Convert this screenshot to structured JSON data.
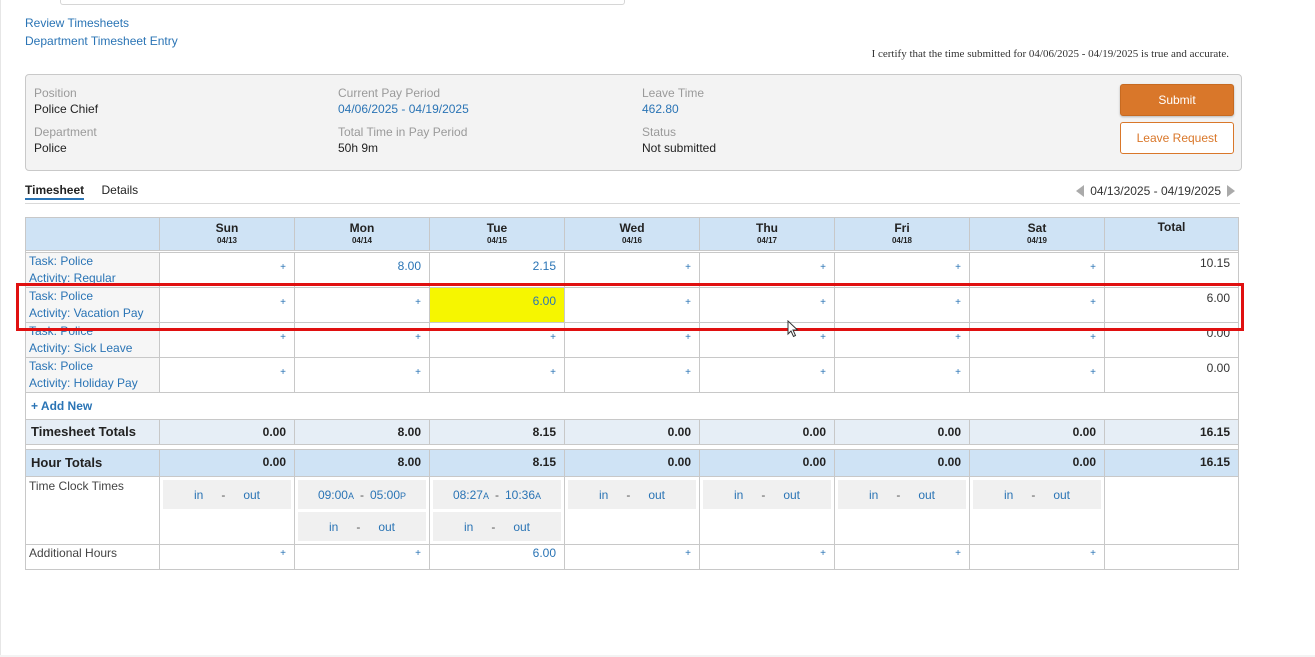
{
  "nav_links": {
    "review_timesheets": "Review Timesheets",
    "department_entry": "Department Timesheet Entry"
  },
  "certify_text": "I certify that the time submitted for 04/06/2025 - 04/19/2025 is true and accurate.",
  "info": {
    "position_label": "Position",
    "position_value": "Police Chief",
    "department_label": "Department",
    "department_value": "Police",
    "pay_period_label": "Current Pay Period",
    "pay_period_value": "04/06/2025 - 04/19/2025",
    "total_time_label": "Total Time in Pay Period",
    "total_time_value": "50h 9m",
    "leave_label": "Leave Time",
    "leave_value": "462.80",
    "status_label": "Status",
    "status_value": "Not submitted"
  },
  "buttons": {
    "submit": "Submit",
    "leave_request": "Leave Request"
  },
  "tabs": [
    "Timesheet",
    "Details"
  ],
  "week_range": "04/13/2025 - 04/19/2025",
  "columns": [
    {
      "day": "Sun",
      "date": "04/13"
    },
    {
      "day": "Mon",
      "date": "04/14"
    },
    {
      "day": "Tue",
      "date": "04/15"
    },
    {
      "day": "Wed",
      "date": "04/16"
    },
    {
      "day": "Thu",
      "date": "04/17"
    },
    {
      "day": "Fri",
      "date": "04/18"
    },
    {
      "day": "Sat",
      "date": "04/19"
    }
  ],
  "total_header": "Total",
  "rows": [
    {
      "task": "Task: Police",
      "activity": "Activity: Regular",
      "cells": [
        "+",
        "8.00",
        "2.15",
        "+",
        "+",
        "+",
        "+"
      ],
      "total": "10.15"
    },
    {
      "task": "Task: Police",
      "activity": "Activity: Vacation Pay",
      "cells": [
        "+",
        "+",
        "6.00",
        "+",
        "+",
        "+",
        "+"
      ],
      "total": "6.00"
    },
    {
      "task": "Task: Police",
      "activity": "Activity: Sick Leave",
      "cells": [
        "+",
        "+",
        "+",
        "+",
        "+",
        "+",
        "+"
      ],
      "total": "0.00"
    },
    {
      "task": "Task: Police",
      "activity": "Activity: Holiday Pay",
      "cells": [
        "+",
        "+",
        "+",
        "+",
        "+",
        "+",
        "+"
      ],
      "total": "0.00"
    }
  ],
  "add_new": "+ Add New",
  "timesheet_totals": {
    "label": "Timesheet Totals",
    "values": [
      "0.00",
      "8.00",
      "8.15",
      "0.00",
      "0.00",
      "0.00",
      "0.00"
    ],
    "total": "16.15"
  },
  "hour_totals": {
    "label": "Hour Totals",
    "values": [
      "0.00",
      "8.00",
      "8.15",
      "0.00",
      "0.00",
      "0.00",
      "0.00"
    ],
    "total": "16.15"
  },
  "time_clock": {
    "label": "Time Clock Times",
    "sun": {
      "in": "in",
      "out": "out"
    },
    "mon": {
      "in": "09:00",
      "in_suffix": "A",
      "out": "05:00",
      "out_suffix": "P",
      "in2": "in",
      "out2": "out"
    },
    "tue": {
      "in": "08:27",
      "in_suffix": "A",
      "out": "10:36",
      "out_suffix": "A",
      "in2": "in",
      "out2": "out"
    },
    "wed": {
      "in": "in",
      "out": "out"
    },
    "thu": {
      "in": "in",
      "out": "out"
    },
    "fri": {
      "in": "in",
      "out": "out"
    },
    "sat": {
      "in": "in",
      "out": "out"
    },
    "dash": "-"
  },
  "additional_hours": {
    "label": "Additional Hours",
    "cells": [
      "+",
      "+",
      "6.00",
      "+",
      "+",
      "+",
      "+"
    ]
  }
}
